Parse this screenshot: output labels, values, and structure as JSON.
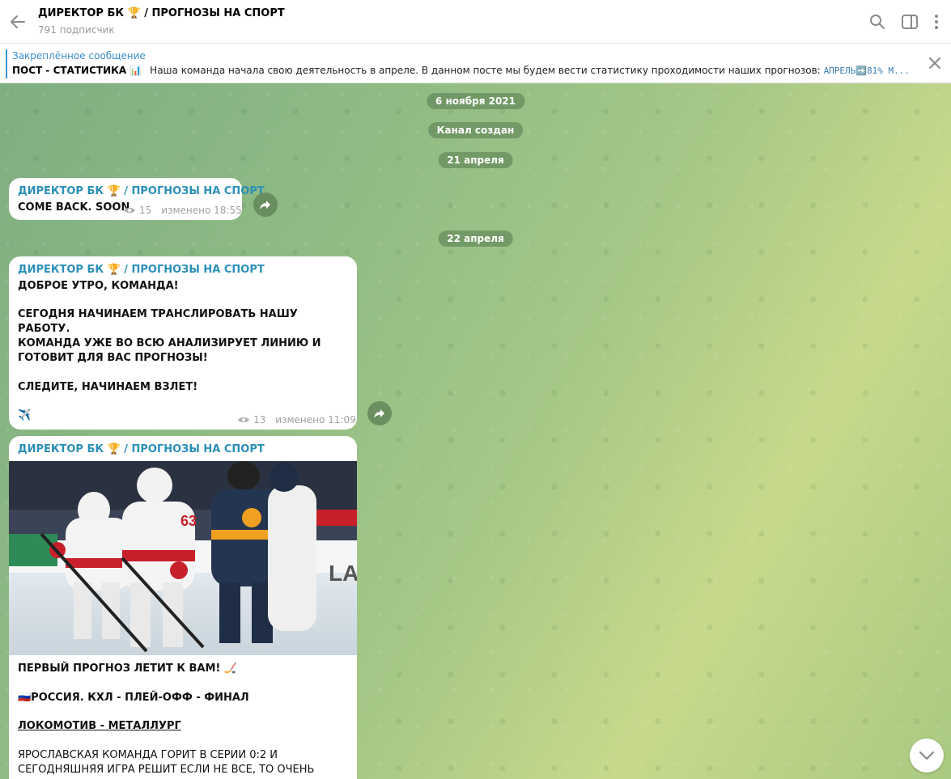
{
  "header": {
    "title": "ДИРЕКТОР БК 🏆 / ПРОГНОЗЫ НА СПОРТ",
    "subscribers": "791 подписчик"
  },
  "pinned": {
    "label": "Закреплённое сообщение",
    "title": "ПОСТ - СТАТИСТИКА 📊",
    "body": "Наша команда начала свою деятельность в апреле. В данном посте мы будем вести статистику проходимости наших прогнозов:",
    "stat": "АПРЕЛЬ➡️81%  М..."
  },
  "dates": {
    "d1": "6 ноября 2021",
    "service": "Канал создан",
    "d2": "21 апреля",
    "d3": "22 апреля"
  },
  "messages": [
    {
      "author": "ДИРЕКТОР БК 🏆 / ПРОГНОЗЫ НА СПОРТ",
      "text": "COME BACK. SOON",
      "views": "15",
      "edited": "изменено 18:55"
    },
    {
      "author": "ДИРЕКТОР БК 🏆 / ПРОГНОЗЫ НА СПОРТ",
      "lines": [
        "ДОБРОЕ УТРО, КОМАНДА!",
        "СЕГОДНЯ НАЧИНАЕМ ТРАНСЛИРОВАТЬ НАШУ РАБОТУ.",
        "КОМАНДА УЖЕ ВО ВСЮ АНАЛИЗИРУЕТ ЛИНИЮ И ГОТОВИТ ДЛЯ ВАС ПРОГНОЗЫ!",
        "СЛЕДИТЕ, НАЧИНАЕМ ВЗЛЕТ!",
        "✈️"
      ],
      "views": "13",
      "edited": "изменено 11:09"
    },
    {
      "author": "ДИРЕКТОР БК 🏆 / ПРОГНОЗЫ НА СПОРТ",
      "photo_text": "LADA",
      "lines": [
        "ПЕРВЫЙ ПРОГНОЗ ЛЕТИТ К ВАМ! 🏒",
        "🇷🇺РОССИЯ. КХЛ - ПЛЕЙ-ОФФ - ФИНАЛ",
        "ЛОКОМОТИВ - МЕТАЛЛУРГ",
        "ЯРОСЛАВСКАЯ КОМАНДА ГОРИТ В СЕРИИ 0:2 И СЕГОДНЯШНЯЯ ИГРА РЕШИТ ЕСЛИ НЕ ВСЕ, ТО ОЧЕНЬ МНОГОЕ!"
      ]
    }
  ],
  "colors": {
    "accent": "#2b8fb8",
    "pinned_accent": "#3a95d5",
    "date_pill": "#668c5c"
  },
  "icons": [
    "back-arrow-icon",
    "search-icon",
    "sidebar-toggle-icon",
    "more-vertical-icon",
    "close-icon",
    "share-icon",
    "eye-icon",
    "chevron-down-icon"
  ]
}
